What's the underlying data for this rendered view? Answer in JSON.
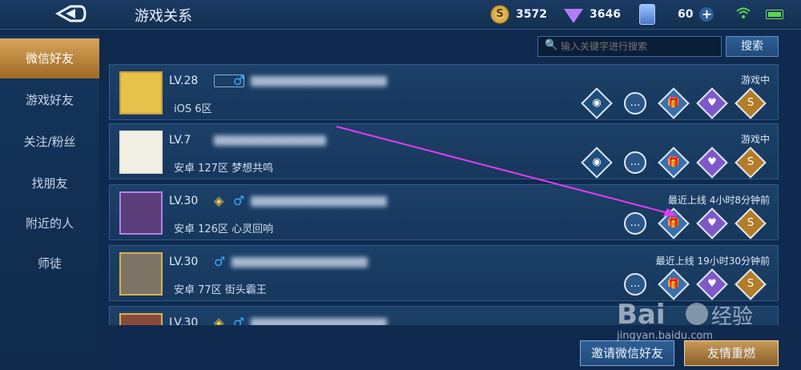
{
  "header": {
    "title": "游戏关系"
  },
  "currencies": [
    {
      "name": "gold-coin",
      "value": "3572"
    },
    {
      "name": "diamond",
      "value": "3646"
    },
    {
      "name": "ticket",
      "value": "60"
    }
  ],
  "sidebar": {
    "items": [
      {
        "label": "微信好友",
        "active": true
      },
      {
        "label": "游戏好友"
      },
      {
        "label": "关注/粉丝"
      },
      {
        "label": "找朋友"
      },
      {
        "label": "附近的人"
      },
      {
        "label": "师徒"
      }
    ]
  },
  "search": {
    "placeholder": "输入关键字进行搜索",
    "button_label": "搜索"
  },
  "friends": [
    {
      "level": "LV.28",
      "server": "iOS 6区",
      "status": "游戏中",
      "avatar": "yellow-square-avatar"
    },
    {
      "level": "LV.7",
      "server": "安卓 127区 梦想共鸣",
      "status": "游戏中",
      "avatar": "flower-avatar"
    },
    {
      "level": "LV.30",
      "server": "安卓 126区 心灵回响",
      "status": "最近上线 4小时8分钟前",
      "avatar": "purple-frame-avatar"
    },
    {
      "level": "LV.30",
      "server": "安卓 77区 街头霸王",
      "status": "最近上线 19小时30分钟前",
      "avatar": "gold-frame-avatar"
    },
    {
      "level": "LV.30",
      "server": "",
      "status": "",
      "avatar": "partial-avatar"
    }
  ],
  "footer": {
    "invite_label": "邀请微信好友",
    "rekindle_label": "友情重燃"
  }
}
